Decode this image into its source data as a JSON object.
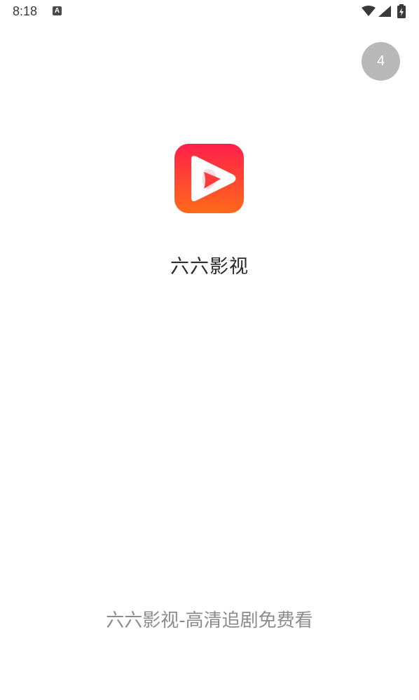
{
  "status_bar": {
    "time": "8:18",
    "notification_icon_label": "A",
    "icons": [
      "wifi-icon",
      "cell-signal-icon",
      "battery-charging-icon"
    ]
  },
  "splash": {
    "skip_countdown": "4",
    "app_name": "六六影视",
    "tagline": "六六影视-高清追剧免费看",
    "logo_icon": "play-logo-icon"
  },
  "colors": {
    "logo_gradient_top": "#ff1f4b",
    "logo_gradient_bottom": "#ff6a1a",
    "skip_bg": "#b8b8b8",
    "app_name_text": "#2b2b2b",
    "tagline_text": "#8c8c8c"
  }
}
